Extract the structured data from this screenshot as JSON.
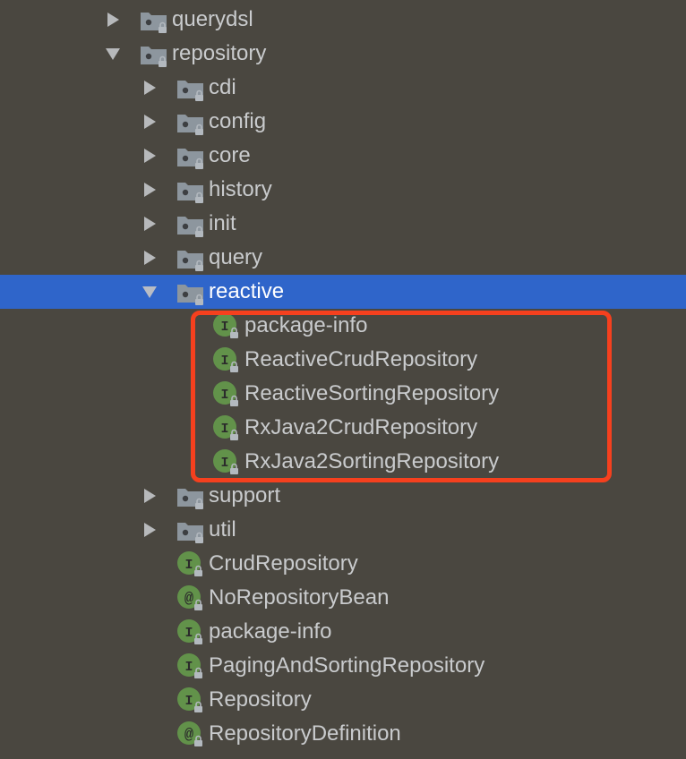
{
  "tree": {
    "items": [
      {
        "label": "querydsl",
        "type": "package",
        "expanded": false,
        "depth": 1
      },
      {
        "label": "repository",
        "type": "package",
        "expanded": true,
        "depth": 1
      },
      {
        "label": "cdi",
        "type": "package",
        "expanded": false,
        "depth": 2
      },
      {
        "label": "config",
        "type": "package",
        "expanded": false,
        "depth": 2
      },
      {
        "label": "core",
        "type": "package",
        "expanded": false,
        "depth": 2
      },
      {
        "label": "history",
        "type": "package",
        "expanded": false,
        "depth": 2
      },
      {
        "label": "init",
        "type": "package",
        "expanded": false,
        "depth": 2
      },
      {
        "label": "query",
        "type": "package",
        "expanded": false,
        "depth": 2
      },
      {
        "label": "reactive",
        "type": "package",
        "expanded": true,
        "depth": 2,
        "selected": true
      },
      {
        "label": "package-info",
        "type": "interface",
        "depth": 3
      },
      {
        "label": "ReactiveCrudRepository",
        "type": "interface",
        "depth": 3
      },
      {
        "label": "ReactiveSortingRepository",
        "type": "interface",
        "depth": 3
      },
      {
        "label": "RxJava2CrudRepository",
        "type": "interface",
        "depth": 3
      },
      {
        "label": "RxJava2SortingRepository",
        "type": "interface",
        "depth": 3
      },
      {
        "label": "support",
        "type": "package",
        "expanded": false,
        "depth": 2
      },
      {
        "label": "util",
        "type": "package",
        "expanded": false,
        "depth": 2
      },
      {
        "label": "CrudRepository",
        "type": "interface",
        "depth": 2
      },
      {
        "label": "NoRepositoryBean",
        "type": "annotation",
        "depth": 2
      },
      {
        "label": "package-info",
        "type": "interface",
        "depth": 2
      },
      {
        "label": "PagingAndSortingRepository",
        "type": "interface",
        "depth": 2
      },
      {
        "label": "Repository",
        "type": "interface",
        "depth": 2
      },
      {
        "label": "RepositoryDefinition",
        "type": "annotation",
        "depth": 2
      }
    ]
  },
  "icons": {
    "interface_glyph": "I",
    "annotation_glyph": "@"
  },
  "colors": {
    "background": "#4a4740",
    "selection": "#2f65ca",
    "highlight_border": "#f5401e",
    "class_icon_green": "#62924a",
    "folder_gray": "#8d969e"
  }
}
